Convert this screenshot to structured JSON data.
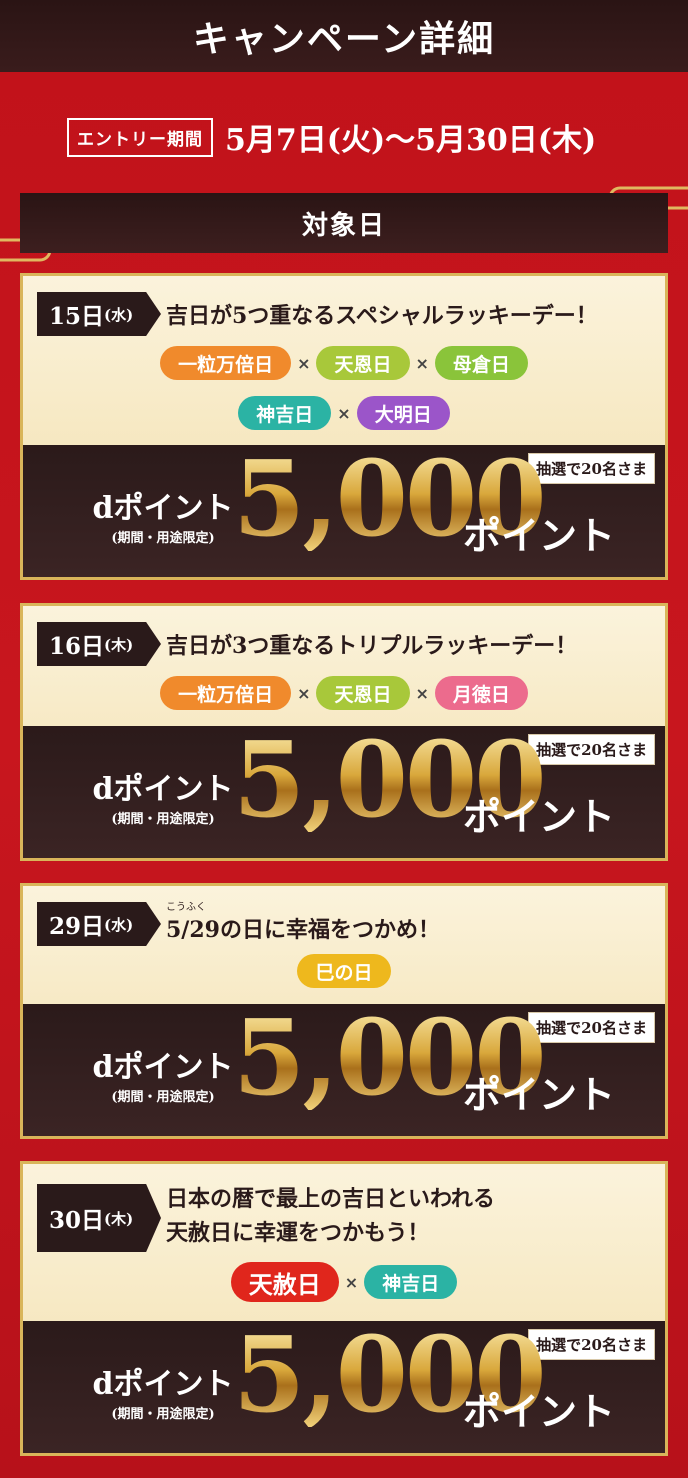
{
  "header": {
    "title": "キャンペーン詳細"
  },
  "entry": {
    "label": "エントリー期間",
    "dates": "5月7日(火)〜5月30日(木)"
  },
  "section": {
    "title": "対象日"
  },
  "cards": [
    {
      "date": "15日",
      "weekday": "(水)",
      "headline": "吉日が5つ重なるスペシャルラッキーデー！",
      "pills_row1": [
        "一粒万倍日",
        "天恩日",
        "母倉日"
      ],
      "pills_row2": [
        "神吉日",
        "大明日"
      ],
      "prize": {
        "lottery": "抽選で20名さま",
        "title": "dポイント",
        "note": "(期間・用途限定)",
        "amount": "5,000",
        "unit": "ポイント"
      }
    },
    {
      "date": "16日",
      "weekday": "(木)",
      "headline": "吉日が3つ重なるトリプルラッキーデー！",
      "pills_row1": [
        "一粒万倍日",
        "天恩日",
        "月徳日"
      ],
      "prize": {
        "lottery": "抽選で20名さま",
        "title": "dポイント",
        "note": "(期間・用途限定)",
        "amount": "5,000",
        "unit": "ポイント"
      }
    },
    {
      "date": "29日",
      "weekday": "(水)",
      "ruby": "こうふく",
      "headline": "5/29の日に幸福をつかめ！",
      "pills_row1": [
        "巳の日"
      ],
      "prize": {
        "lottery": "抽選で20名さま",
        "title": "dポイント",
        "note": "(期間・用途限定)",
        "amount": "5,000",
        "unit": "ポイント"
      }
    },
    {
      "date": "30日",
      "weekday": "(木)",
      "headline_line1": "日本の暦で最上の吉日といわれる",
      "headline_line2": "天赦日に幸運をつかもう！",
      "pills_row1": [
        "天赦日",
        "神吉日"
      ],
      "prize": {
        "lottery": "抽選で20名さま",
        "title": "dポイント",
        "note": "(期間・用途限定)",
        "amount": "5,000",
        "unit": "ポイント"
      }
    }
  ],
  "times_symbol": "×",
  "colors": {
    "bg_red": "#c8141c",
    "dark": "#2a1a1a",
    "gold": "#d9b55a"
  }
}
